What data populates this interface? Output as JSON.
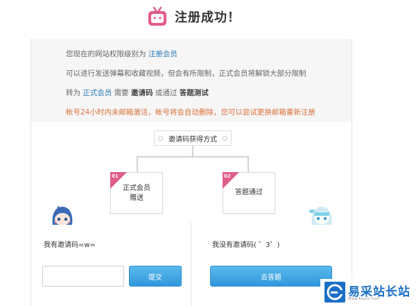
{
  "header": {
    "title": "注册成功！"
  },
  "info": {
    "line1_prefix": "您现在的网站权限级别为",
    "line1_level": "注册会员",
    "line2": "可以进行发送弹幕和收藏视频，但会有所限制，正式会员将解锁大部分限制",
    "line3_prefix": "转为",
    "line3_target": "正式会员",
    "line3_need": "需要",
    "line3_code": "邀请码",
    "line3_or": "或通过",
    "line3_test": "答题测试",
    "line4": "帐号24小时内未邮箱激活，帐号将会自动删除，您可以尝试更换邮箱重新注册"
  },
  "diagram": {
    "method_label": "邀请码获得方式",
    "options": [
      {
        "badge": "01",
        "label_line1": "正式会员",
        "label_line2": "赠送"
      },
      {
        "badge": "02",
        "label_line1": "答题通过",
        "label_line2": ""
      }
    ]
  },
  "left_panel": {
    "title": "我有邀请码=w=",
    "input_value": "",
    "submit_label": "提交"
  },
  "right_panel": {
    "title": "我没有邀请码(  ゜3゜)",
    "answer_label": "去答题"
  },
  "watermark": {
    "name": "易采站长站",
    "sub": "Www.Easck.Com"
  },
  "colors": {
    "accent_pink": "#e05c8a",
    "link_blue": "#2a7ab8",
    "button_blue": "#2f98dc",
    "warn_orange": "#d9713a"
  }
}
